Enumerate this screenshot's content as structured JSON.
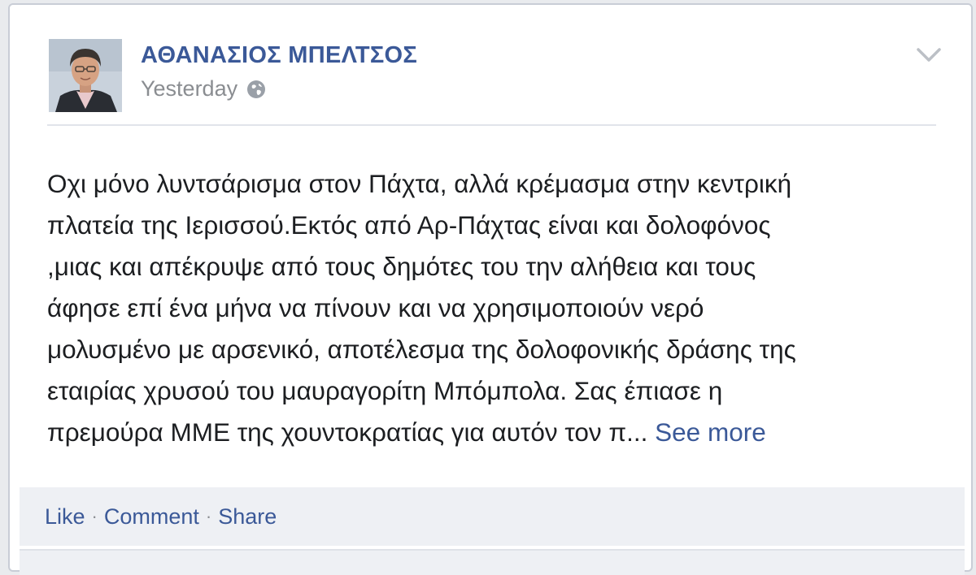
{
  "post": {
    "author": "ΑΘΑΝΑΣΙΟΣ ΜΠΕΛΤΣΟΣ",
    "timestamp": "Yesterday",
    "privacy_icon": "globe-icon",
    "menu_icon": "chevron-down-icon",
    "text_lines": [
      "Οχι μόνο λυντσάρισμα στον Πάχτα, αλλά κρέμασμα στην κεντρική",
      "πλατεία της Ιερισσού.Εκτός από Αρ-Πάχτας είναι και δολοφόνος",
      ",μιας και απέκρυψε από τους δημότες του την αλήθεια και τους",
      "άφησε επί ένα μήνα να πίνουν και να χρησιμοποιούν νερό",
      "μολυσμένο με αρσενικό, αποτέλεσμα της δολοφονικής δράσης της",
      "εταιρίας χρυσού του μαυραγορίτη Μπόμπολα. Σας έπιασε η",
      "πρεμούρα ΜΜΕ της χουντοκρατίας για αυτόν τον π..."
    ],
    "see_more": "See more"
  },
  "actions": {
    "like": "Like",
    "comment": "Comment",
    "share": "Share",
    "separator": "·"
  },
  "colors": {
    "link": "#3b5998",
    "text": "#1c1e21",
    "muted": "#8a8d91",
    "action_bar_bg": "#eef0f4"
  }
}
